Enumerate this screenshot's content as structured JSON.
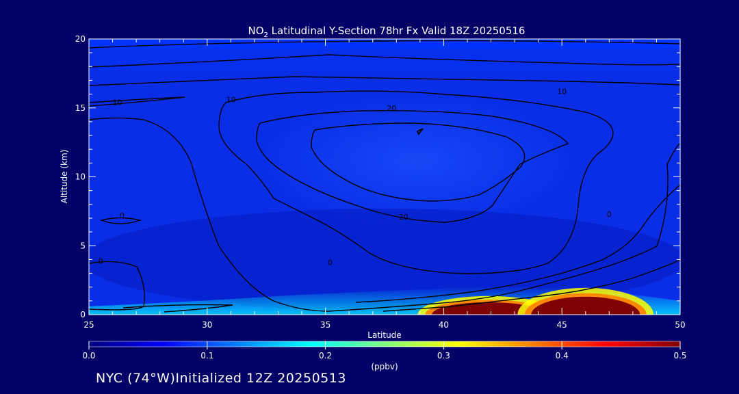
{
  "colors": {
    "background": "#000066",
    "colormap": [
      "#00007f",
      "#0000ff",
      "#007fff",
      "#00ffff",
      "#7fff7f",
      "#ffff00",
      "#ff7f00",
      "#ff0000",
      "#7f0000"
    ]
  },
  "footer_text": "NYC (74°W)Initialized 12Z 20250513",
  "chart_data": {
    "type": "heatmap",
    "title_parts": {
      "pre": "NO",
      "sub": "2",
      "post": " Latitudinal Y-Section 78hr  Fx Valid 18Z 20250516"
    },
    "xlabel": "Latitude",
    "ylabel": "Altitude (km)",
    "xlim": [
      25,
      50
    ],
    "ylim": [
      0,
      20
    ],
    "xticks": [
      25,
      30,
      35,
      40,
      45,
      50
    ],
    "yticks": [
      0,
      5,
      10,
      15,
      20
    ],
    "colorbar": {
      "range": [
        0.0,
        0.5
      ],
      "ticks": [
        "0.0",
        "0.1",
        "0.2",
        "0.3",
        "0.4",
        "0.5"
      ],
      "unit": "(ppbv)"
    },
    "contour_labels": [
      {
        "text": "0",
        "lat": 37.2,
        "alt": 20.0
      },
      {
        "text": "10",
        "lat": 26.2,
        "alt": 15.4
      },
      {
        "text": "10",
        "lat": 31.0,
        "alt": 15.6
      },
      {
        "text": "10",
        "lat": 45.0,
        "alt": 16.2
      },
      {
        "text": "20",
        "lat": 37.8,
        "alt": 15.0
      },
      {
        "text": "20",
        "lat": 38.3,
        "alt": 7.1
      },
      {
        "text": "0",
        "lat": 26.4,
        "alt": 7.2
      },
      {
        "text": "0",
        "lat": 25.5,
        "alt": 3.9
      },
      {
        "text": "0",
        "lat": 35.2,
        "alt": 3.8
      },
      {
        "text": "0",
        "lat": 47.0,
        "alt": 7.3
      }
    ],
    "hotspots": [
      {
        "lat_center": 41.9,
        "lat_halfwidth": 2.4,
        "alt_top": 0.9,
        "value": 0.5
      },
      {
        "lat_center": 46.0,
        "lat_halfwidth": 2.3,
        "alt_top": 1.3,
        "value": 0.5
      }
    ]
  }
}
